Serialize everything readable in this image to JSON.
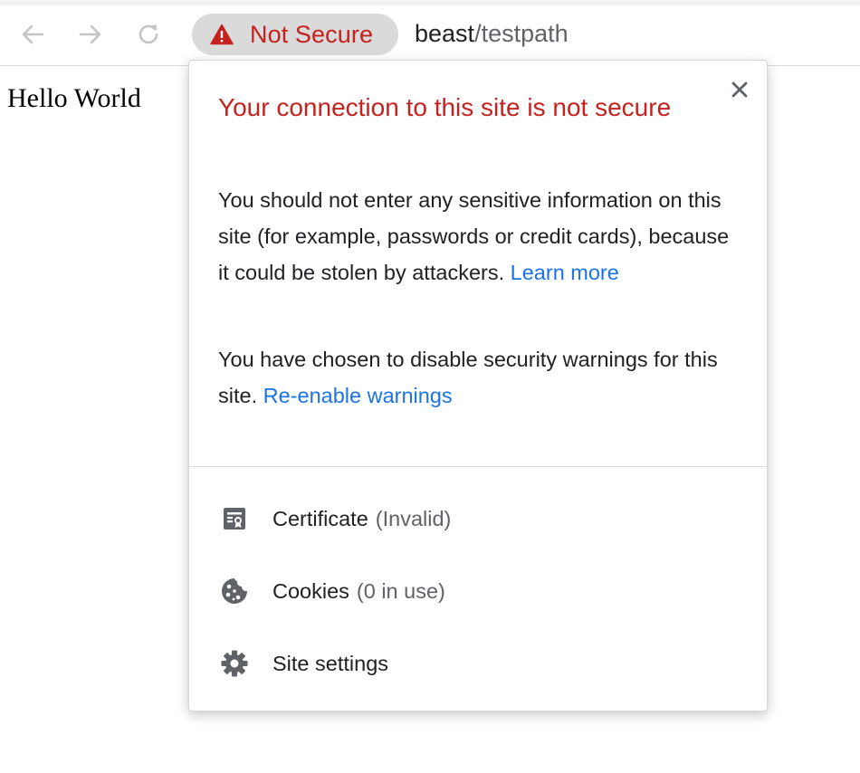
{
  "toolbar": {
    "security_chip_label": "Not Secure",
    "url_host": "beast",
    "url_path": "/testpath"
  },
  "page": {
    "content_text": "Hello World"
  },
  "popup": {
    "title": "Your connection to this site is not secure",
    "warning_text": "You should not enter any sensitive information on this site (for example, passwords or credit cards), because it could be stolen by attackers. ",
    "learn_more_link": "Learn more",
    "disabled_text": "You have chosen to disable security warnings for this site. ",
    "reenable_link": "Re-enable warnings",
    "items": [
      {
        "icon": "certificate-icon",
        "label": "Certificate",
        "status": "(Invalid)"
      },
      {
        "icon": "cookie-icon",
        "label": "Cookies",
        "status": "(0 in use)"
      },
      {
        "icon": "gear-icon",
        "label": "Site settings",
        "status": ""
      }
    ]
  },
  "colors": {
    "warning_red": "#c5221f",
    "link_blue": "#1a73e8",
    "chip_bg": "#dadada",
    "icon_gray": "#5f6368"
  }
}
